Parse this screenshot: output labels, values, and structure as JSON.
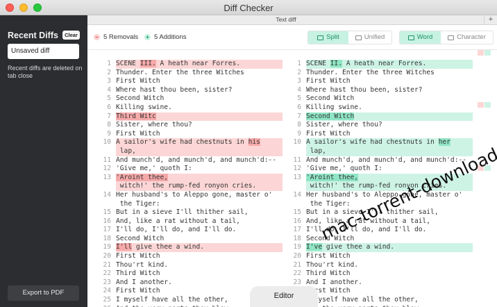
{
  "window": {
    "title": "Diff Checker"
  },
  "sidebar": {
    "heading": "Recent Diffs",
    "clear_label": "Clear",
    "items": [
      {
        "label": "Unsaved diff"
      }
    ],
    "note": "Recent diffs are deleted on tab close",
    "export_label": "Export to PDF"
  },
  "tabbar": {
    "title": "Text diff",
    "add_label": "+"
  },
  "toolbar": {
    "removals": "5 Removals",
    "additions": "5 Additions",
    "view_modes": [
      {
        "label": "Split",
        "active": true
      },
      {
        "label": "Unified",
        "active": false
      }
    ],
    "granularity": [
      {
        "label": "Word",
        "active": true
      },
      {
        "label": "Character",
        "active": false
      }
    ]
  },
  "diff": {
    "left": [
      {
        "n": "1",
        "t": "SCENE III. A heath near Forres.",
        "type": "del",
        "hl": "III."
      },
      {
        "n": "2",
        "t": "Thunder. Enter the three Witches"
      },
      {
        "n": "3",
        "t": "First Witch"
      },
      {
        "n": "4",
        "t": "Where hast thou been, sister?"
      },
      {
        "n": "5",
        "t": "Second Witch"
      },
      {
        "n": "6",
        "t": "Killing swine."
      },
      {
        "n": "7",
        "t": "Third Witc",
        "type": "del",
        "hl": "Third Witc"
      },
      {
        "n": "8",
        "t": "Sister, where thou?"
      },
      {
        "n": "9",
        "t": "First Witch"
      },
      {
        "n": "10",
        "t": "A sailor's wife had chestnuts in his\n lap,",
        "type": "del",
        "hl": "his",
        "tall": true
      },
      {
        "n": "11",
        "t": "And munch'd, and munch'd, and munch'd:--"
      },
      {
        "n": "12",
        "t": "'Give me,' quoth I:"
      },
      {
        "n": "13",
        "t": "'Aroint thee,\n witch!' the rump-fed ronyon cries.",
        "type": "del",
        "hl": "'Aroint thee,",
        "tall": true
      },
      {
        "n": "14",
        "t": "Her husband's to Aleppo gone, master o'\n the Tiger:",
        "tall": true
      },
      {
        "n": "15",
        "t": "But in a sieve I'll thither sail,"
      },
      {
        "n": "16",
        "t": "And, like a rat without a tail,"
      },
      {
        "n": "17",
        "t": "I'll do, I'll do, and I'll do."
      },
      {
        "n": "18",
        "t": "Second Witch"
      },
      {
        "n": "19",
        "t": "I'll give thee a wind.",
        "type": "del",
        "hl": "I'll"
      },
      {
        "n": "20",
        "t": "First Witch"
      },
      {
        "n": "21",
        "t": "Thou'rt kind."
      },
      {
        "n": "22",
        "t": "Third Witch"
      },
      {
        "n": "23",
        "t": "And I another."
      },
      {
        "n": "24",
        "t": "First Witch"
      },
      {
        "n": "25",
        "t": "I myself have all the other,"
      },
      {
        "n": "26",
        "t": "And the very ports they blow,"
      }
    ],
    "right": [
      {
        "n": "1",
        "t": "SCENE II. A heath near Forres.",
        "type": "add",
        "hl": "II."
      },
      {
        "n": "2",
        "t": "Thunder. Enter the three Witches"
      },
      {
        "n": "3",
        "t": "First Witch"
      },
      {
        "n": "4",
        "t": "Where hast thou been, sister?"
      },
      {
        "n": "5",
        "t": "Second Witch"
      },
      {
        "n": "6",
        "t": "Killing swine."
      },
      {
        "n": "7",
        "t": "Second Witch",
        "type": "add",
        "hl": "Second Witch"
      },
      {
        "n": "8",
        "t": "Sister, where thou?"
      },
      {
        "n": "9",
        "t": "First Witch"
      },
      {
        "n": "10",
        "t": "A sailor's wife had chestnuts in her\n lap,",
        "type": "add",
        "hl": "her",
        "tall": true
      },
      {
        "n": "11",
        "t": "And munch'd, and munch'd, and munch'd:--"
      },
      {
        "n": "12",
        "t": "'Give me,' quoth I:"
      },
      {
        "n": "13",
        "t": "'Aroint thee,\n witch!' the rump-fed ronyon cries.",
        "type": "add",
        "hl": "'Aroint thee,",
        "tall": true
      },
      {
        "n": "14",
        "t": "Her husband's to Aleppo gone, master o'\n the Tiger:",
        "tall": true
      },
      {
        "n": "15",
        "t": "But in a sieve I'll thither sail,"
      },
      {
        "n": "16",
        "t": "And, like a rat without a tail,"
      },
      {
        "n": "17",
        "t": "I'll do, I'll do, and I'll do."
      },
      {
        "n": "18",
        "t": "Second Witch"
      },
      {
        "n": "19",
        "t": "I've give thee a wind.",
        "type": "add",
        "hl": "I've"
      },
      {
        "n": "20",
        "t": "First Witch"
      },
      {
        "n": "21",
        "t": "Thou'rt kind."
      },
      {
        "n": "22",
        "t": "Third Witch"
      },
      {
        "n": "23",
        "t": "And I another."
      },
      {
        "n": "24",
        "t": "First Witch"
      },
      {
        "n": "25",
        "t": "I myself have all the other,"
      },
      {
        "n": "26",
        "t": "And the very ports they blow,"
      }
    ]
  },
  "editor_tab": "Editor",
  "watermark": "mac-torrent-download.net",
  "colors": {
    "removal": "#fcd6d6",
    "removal_strong": "#f6a9a9",
    "addition": "#cdf3e5",
    "addition_strong": "#8fe5c5",
    "accent": "#1c8f66",
    "sidebar": "#2b2d30"
  }
}
